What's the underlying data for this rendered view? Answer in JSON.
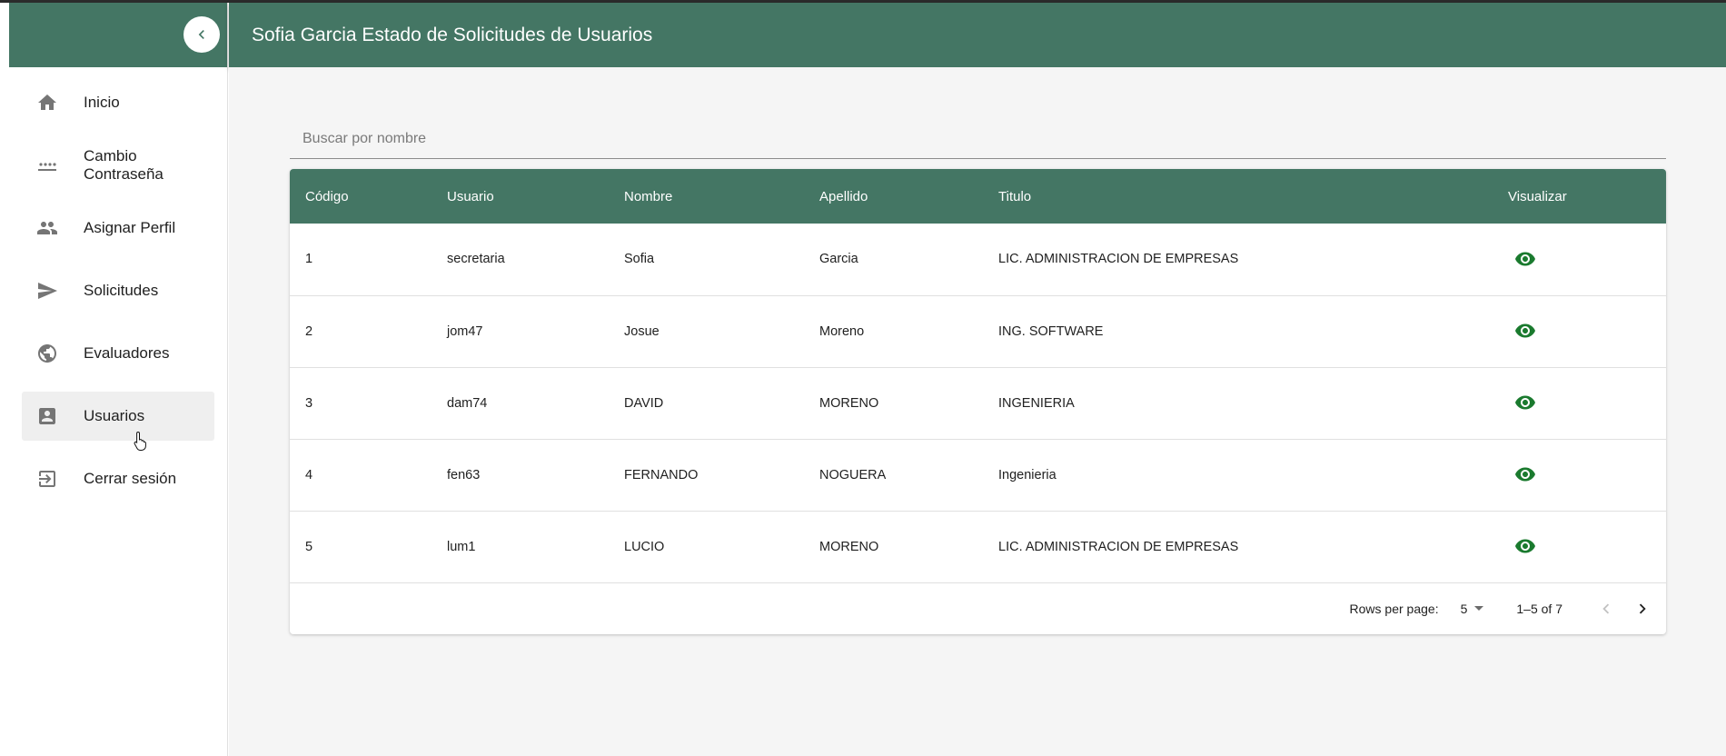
{
  "header": {
    "title": "Sofia Garcia Estado de Solicitudes de Usuarios"
  },
  "theme": {
    "primary": "#447664",
    "view_icon": "#1a7a2e"
  },
  "sidebar": {
    "collapse_icon": "chevron-left-icon",
    "items": [
      {
        "label": "Inicio",
        "icon": "home-icon",
        "active": false
      },
      {
        "label": "Cambio Contraseña",
        "icon": "password-icon",
        "active": false
      },
      {
        "label": "Asignar Perfil",
        "icon": "people-icon",
        "active": false
      },
      {
        "label": "Solicitudes",
        "icon": "send-icon",
        "active": false
      },
      {
        "label": "Evaluadores",
        "icon": "face-icon",
        "active": false
      },
      {
        "label": "Usuarios",
        "icon": "account-box-icon",
        "active": true
      },
      {
        "label": "Cerrar sesión",
        "icon": "logout-icon",
        "active": false
      }
    ]
  },
  "search": {
    "placeholder": "Buscar por nombre",
    "value": ""
  },
  "table": {
    "columns": [
      "Código",
      "Usuario",
      "Nombre",
      "Apellido",
      "Titulo",
      "Visualizar"
    ],
    "rows": [
      {
        "codigo": "1",
        "usuario": "secretaria",
        "nombre": "Sofia",
        "apellido": "Garcia",
        "titulo": "LIC. ADMINISTRACION DE EMPRESAS"
      },
      {
        "codigo": "2",
        "usuario": "jom47",
        "nombre": "Josue",
        "apellido": "Moreno",
        "titulo": "ING. SOFTWARE"
      },
      {
        "codigo": "3",
        "usuario": "dam74",
        "nombre": "DAVID",
        "apellido": "MORENO",
        "titulo": "INGENIERIA"
      },
      {
        "codigo": "4",
        "usuario": "fen63",
        "nombre": "FERNANDO",
        "apellido": "NOGUERA",
        "titulo": "Ingenieria"
      },
      {
        "codigo": "5",
        "usuario": "lum1",
        "nombre": "LUCIO",
        "apellido": "MORENO",
        "titulo": "LIC. ADMINISTRACION DE EMPRESAS"
      }
    ],
    "view_icon": "eye-icon"
  },
  "pagination": {
    "rows_per_page_label": "Rows per page:",
    "rows_per_page": "5",
    "range": "1–5 of 7"
  }
}
